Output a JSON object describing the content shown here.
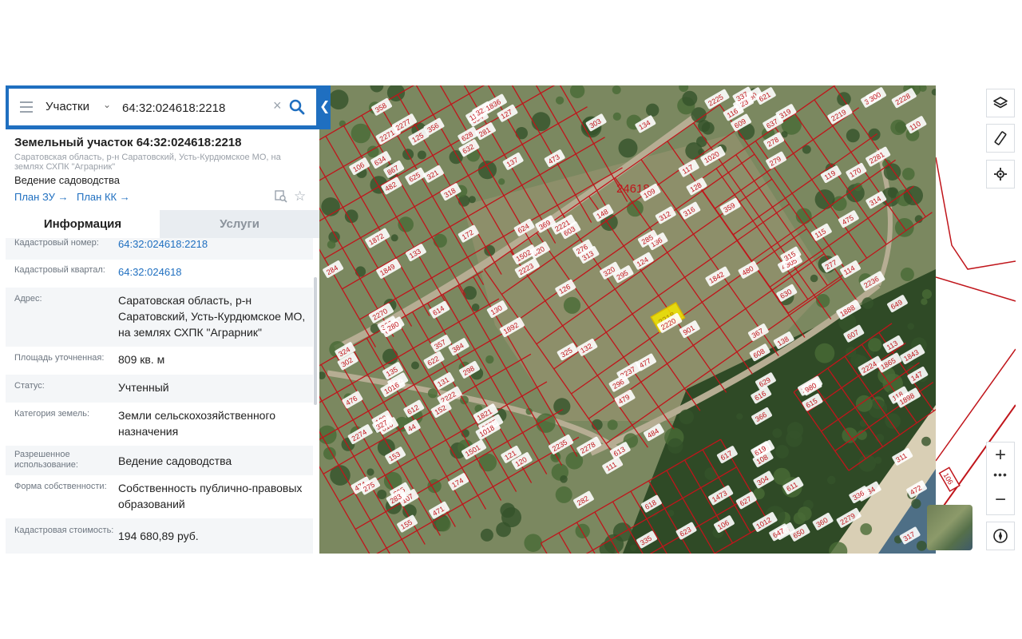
{
  "search": {
    "layer_label": "Участки",
    "query": "64:32:024618:2218"
  },
  "parcel": {
    "title": "Земельный участок 64:32:024618:2218",
    "address_short": "Саратовская область, р-н Саратовский, Усть-Курдюмское МО, на землях СХПК \"Аграрник\"",
    "use": "Ведение садоводства",
    "links": [
      "План ЗУ",
      "План КК"
    ]
  },
  "tabs": [
    "Информация",
    "Услуги"
  ],
  "info_rows": [
    {
      "label": "Кадастровый номер:",
      "value": "64:32:024618:2218",
      "link": true
    },
    {
      "label": "Кадастровый квартал:",
      "value": "64:32:024618",
      "link": true
    },
    {
      "label": "Адрес:",
      "value": "Саратовская область, р-н Саратовский, Усть-Курдюмское МО, на землях СХПК \"Аграрник\""
    },
    {
      "label": "Площадь уточненная:",
      "value": "809 кв. м"
    },
    {
      "label": "Статус:",
      "value": "Учтенный"
    },
    {
      "label": "Категория земель:",
      "value": "Земли сельскохозяйственного назначения"
    },
    {
      "label": "Разрешенное использование:",
      "value": "Ведение садоводства"
    },
    {
      "label": "Форма собственности:",
      "value": "Собственность публично-правовых образований"
    },
    {
      "label": "Кадастровая стоимость:",
      "value": "194 680,89 руб."
    }
  ],
  "map": {
    "quarter_label": "24618",
    "selected_parcel": "2218",
    "parcel_labels": [
      "608",
      "607",
      "605",
      "604",
      "603",
      "611",
      "610",
      "609",
      "624",
      "623",
      "634",
      "2270",
      "2271",
      "2234",
      "2235",
      "2236",
      "2237",
      "2220",
      "2221",
      "2222",
      "2228",
      "2219",
      "2223",
      "2224",
      "2225",
      "628",
      "629",
      "631",
      "632",
      "630",
      "618",
      "617",
      "620",
      "1892",
      "1888",
      "615",
      "616",
      "614",
      "613",
      "612",
      "2281",
      "2280",
      "2279",
      "2278",
      "2276",
      "2275",
      "2274",
      "2277",
      "1842",
      "1849",
      "1843",
      "369",
      "368",
      "367",
      "366",
      "360",
      "359",
      "358",
      "357",
      "356",
      "138",
      "137",
      "136",
      "135",
      "134",
      "133",
      "132",
      "131",
      "130",
      "129",
      "128",
      "127",
      "126",
      "125",
      "124",
      "123",
      "122",
      "121",
      "120",
      "119",
      "118",
      "117",
      "116",
      "115",
      "114",
      "113",
      "112",
      "111",
      "110",
      "109",
      "108",
      "107",
      "106",
      "1898",
      "480",
      "482",
      "484",
      "474",
      "476",
      "478",
      "479",
      "471",
      "472",
      "473",
      "475",
      "477",
      "302",
      "303",
      "304",
      "305",
      "298",
      "300",
      "311",
      "312",
      "313",
      "314",
      "315",
      "316",
      "317",
      "318",
      "319",
      "320",
      "321",
      "322",
      "323",
      "324",
      "325",
      "326",
      "327",
      "335",
      "336",
      "337",
      "147",
      "148",
      "152",
      "153",
      "155",
      "170",
      "174",
      "172",
      "44",
      "1020",
      "1016",
      "1018",
      "1012",
      "1872",
      "901",
      "980",
      "296",
      "295",
      "384",
      "106",
      "1821",
      "1836",
      "1865",
      "1501",
      "1502",
      "1473",
      "626",
      "627",
      "625",
      "622",
      "621",
      "619",
      "650",
      "647",
      "637",
      "649",
      "867",
      "285",
      "284",
      "283",
      "282",
      "281",
      "280",
      "279",
      "275",
      "276",
      "277",
      "278"
    ],
    "icons": [
      "layers-icon",
      "ruler-icon",
      "locate-icon",
      "zoom-in-icon",
      "more-icon",
      "zoom-out-icon",
      "compass-icon"
    ],
    "colors": {
      "boundary": "#c0151b",
      "label_bg": "#ffffff",
      "selected_fill": "#f3e600",
      "accent": "#1f6fc0"
    }
  }
}
